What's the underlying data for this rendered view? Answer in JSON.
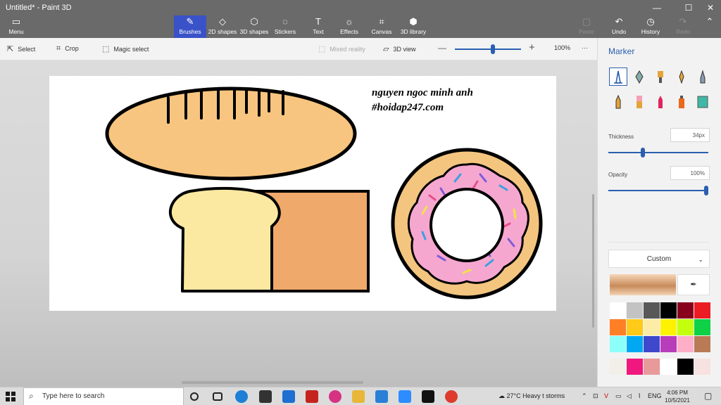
{
  "window": {
    "title": "Untitled* - Paint 3D",
    "controls": {
      "minimize": "—",
      "maximize": "☐",
      "close": "✕"
    }
  },
  "toolbar": {
    "menu_label": "Menu",
    "tabs": [
      {
        "label": "Brushes",
        "icon": "brush-icon",
        "active": true
      },
      {
        "label": "2D shapes",
        "icon": "2d-shapes-icon"
      },
      {
        "label": "3D shapes",
        "icon": "3d-shapes-icon"
      },
      {
        "label": "Stickers",
        "icon": "stickers-icon"
      },
      {
        "label": "Text",
        "icon": "text-icon"
      },
      {
        "label": "Effects",
        "icon": "effects-icon"
      },
      {
        "label": "Canvas",
        "icon": "canvas-icon"
      },
      {
        "label": "3D library",
        "icon": "3d-library-icon"
      }
    ],
    "right": [
      {
        "label": "Paste",
        "icon": "paste-icon",
        "enabled": false
      },
      {
        "label": "Undo",
        "icon": "undo-icon",
        "enabled": true
      },
      {
        "label": "History",
        "icon": "history-icon",
        "enabled": true
      },
      {
        "label": "Redo",
        "icon": "redo-icon",
        "enabled": false
      }
    ]
  },
  "subtoolbar": {
    "select": "Select",
    "crop": "Crop",
    "magic_select": "Magic select",
    "mixed_reality": "Mixed reality",
    "view_3d": "3D view",
    "zoom": "100%",
    "zoom_fraction": 0.58,
    "more": "···"
  },
  "canvas": {
    "text_line1": "nguyen ngoc minh anh",
    "text_line2": "#hoidap247.com"
  },
  "panel": {
    "title": "Marker",
    "thickness_label": "Thickness",
    "thickness_value": "34px",
    "thickness_fraction": 0.34,
    "opacity_label": "Opacity",
    "opacity_value": "100%",
    "opacity_fraction": 1.0,
    "color_mode": "Custom",
    "current_color": "#d99a66",
    "palette": [
      "#ffffff",
      "#c3c3c3",
      "#585858",
      "#000000",
      "#88001b",
      "#ec1c24",
      "#ff7f27",
      "#ffca18",
      "#fdeca6",
      "#fff200",
      "#c4ff0e",
      "#0ed145",
      "#8cfffb",
      "#00a8f3",
      "#3f48cc",
      "#b83dba",
      "#ffaec8",
      "#b97a56"
    ],
    "custom_palette": [
      "#f2efe8",
      "#f0187e",
      "#e89a9a",
      "#ffffff",
      "#000000",
      "#f8e1e1"
    ]
  },
  "taskbar": {
    "search_placeholder": "Type here to search",
    "weather": "27°C  Heavy t storms",
    "language": "ENG",
    "time": "4:06 PM",
    "date": "10/5/2021"
  }
}
